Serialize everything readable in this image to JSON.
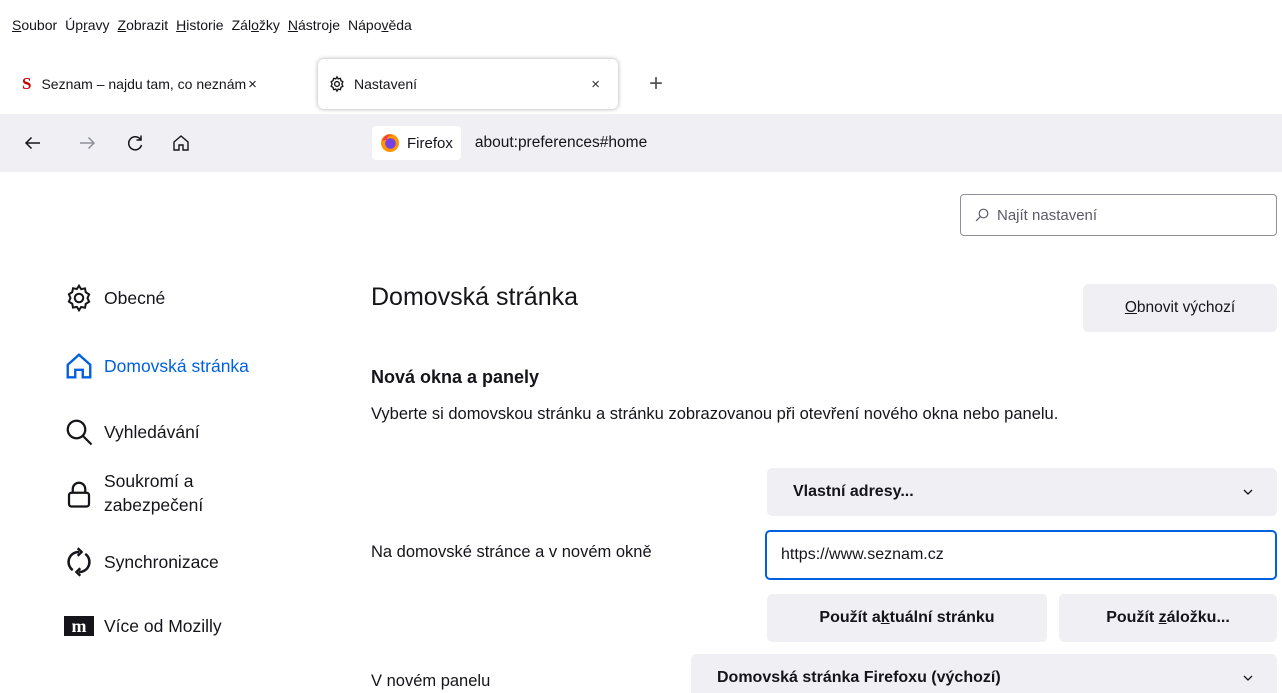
{
  "menubar": {
    "items": [
      {
        "pre": "",
        "key": "S",
        "post": "oubor"
      },
      {
        "pre": "Úp",
        "key": "r",
        "post": "avy"
      },
      {
        "pre": "",
        "key": "Z",
        "post": "obrazit"
      },
      {
        "pre": "",
        "key": "H",
        "post": "istorie"
      },
      {
        "pre": "Zál",
        "key": "o",
        "post": "žky"
      },
      {
        "pre": "",
        "key": "N",
        "post": "ástroje"
      },
      {
        "pre": "Nápo",
        "key": "v",
        "post": "ěda"
      }
    ]
  },
  "tabs": {
    "seznam": {
      "favicon": "S",
      "label": "Seznam – najdu tam, co neznám",
      "close": "×"
    },
    "settings": {
      "label": "Nastavení",
      "close": "×"
    },
    "new_tab": "+"
  },
  "navbar": {
    "identity_label": "Firefox",
    "url": "about:preferences#home"
  },
  "search": {
    "placeholder": "Najít nastavení"
  },
  "sidebar": {
    "items": [
      {
        "label": "Obecné",
        "icon": "gear-icon"
      },
      {
        "label": "Domovská stránka",
        "icon": "home-icon"
      },
      {
        "label": "Vyhledávání",
        "icon": "search-icon"
      },
      {
        "label_line1": "Soukromí a",
        "label_line2": "zabezpečení",
        "icon": "lock-icon"
      },
      {
        "label": "Synchronizace",
        "icon": "sync-icon"
      },
      {
        "label": "Více od Mozilly",
        "icon": "mozilla-m-icon"
      }
    ]
  },
  "main": {
    "title": "Domovská stránka",
    "restore": {
      "pre": "",
      "key": "O",
      "post": "bnovit výchozí"
    },
    "subheading": "Nová okna a panely",
    "description": "Vyberte si domovskou stránku a stránku zobrazovanou při otevření nového okna nebo panelu.",
    "home_select": "Vlastní adresy...",
    "home_label": "Na domovské stránce a v novém okně",
    "home_url": "https://www.seznam.cz",
    "use_current": {
      "pre": "Použít a",
      "key": "k",
      "post": "tuální stránku"
    },
    "use_bookmark": {
      "pre": "Použít ",
      "key": "z",
      "post": "áložku..."
    },
    "newtab_label": "V novém panelu",
    "newtab_select": "Domovská stránka Firefoxu (výchozí)"
  },
  "colors": {
    "accent": "#0061e0",
    "toolbar_bg": "#f0f0f4",
    "button_bg": "#f0f0f4",
    "text": "#15141a",
    "seznam_red": "#cc0000"
  }
}
